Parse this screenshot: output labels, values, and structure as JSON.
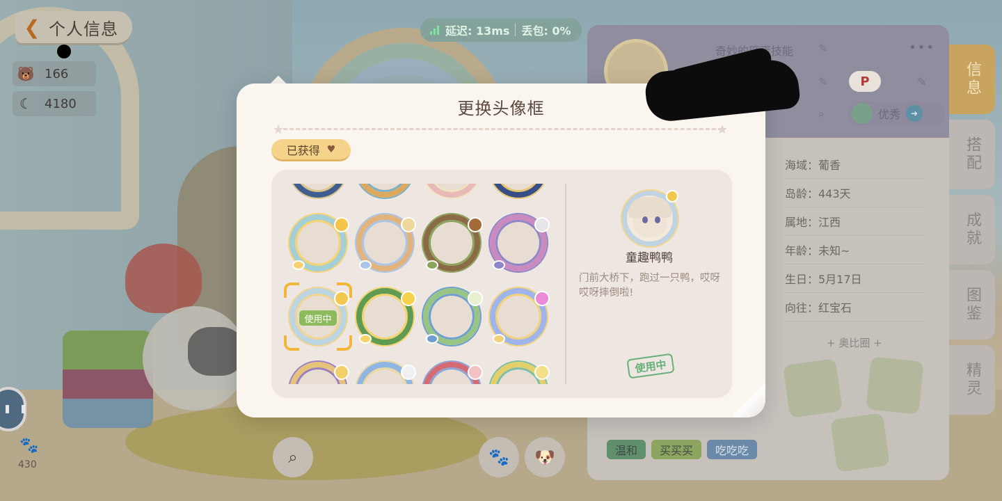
{
  "header": {
    "back_label": "个人信息",
    "stats": [
      {
        "icon": "bear-icon",
        "value": "166"
      },
      {
        "icon": "moon-icon",
        "value": "4180"
      }
    ]
  },
  "network": {
    "latency": "延迟: 13ms",
    "packet_loss": "丢包: 0%"
  },
  "profile": {
    "nickname": "奇妙的砸蛋技能",
    "badge": "P",
    "rating": "优秀",
    "info": [
      "海域：葡香",
      "岛龄：443天",
      "属地：江西",
      "年龄：未知~",
      "生日：5月17日",
      "向往：红宝石"
    ],
    "circle_title": "+ 奥比圈 +",
    "tags": [
      "温和",
      "买买买",
      "吃吃吃"
    ],
    "side_tabs": [
      "信息",
      "搭配",
      "成就",
      "图鉴",
      "精灵"
    ],
    "active_tab": "信息"
  },
  "bottom": {
    "left_count": "430"
  },
  "modal": {
    "title": "更换头像框",
    "filter_label": "已获得",
    "in_use_label": "使用中",
    "selected_frame": {
      "name": "童趣鸭鸭",
      "description": "门前大桥下，跑过一只鸭，哎呀哎呀摔倒啦!",
      "status_stamp": "使用中"
    }
  },
  "colors": {
    "modal_bg": "#fbf5f0",
    "accent_yellow": "#f6d38a",
    "selection_orange": "#f2b63a",
    "in_use_green": "#66b07a"
  }
}
